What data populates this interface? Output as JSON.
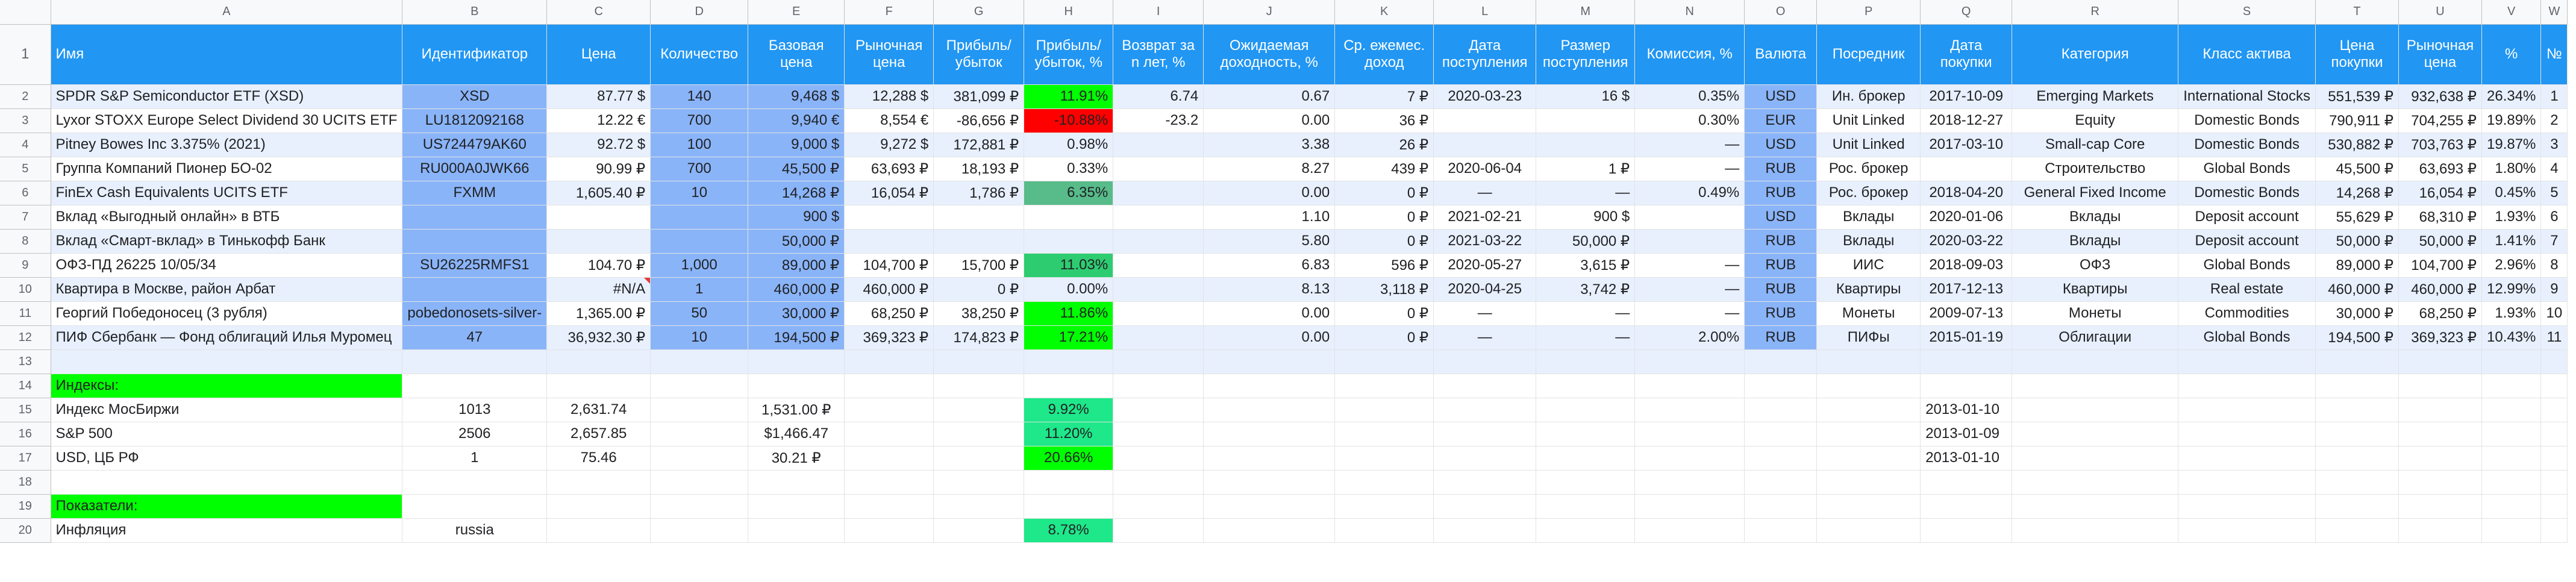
{
  "columns": [
    "A",
    "B",
    "C",
    "D",
    "E",
    "F",
    "G",
    "H",
    "I",
    "J",
    "K",
    "L",
    "M",
    "N",
    "O",
    "P",
    "Q",
    "R",
    "S",
    "T",
    "U",
    "V",
    "W"
  ],
  "header": [
    "Имя",
    "Идентификатор",
    "Цена",
    "Количество",
    "Базовая цена",
    "Рыночная цена",
    "Прибыль/ убыток",
    "Прибыль/ убыток, %",
    "Возврат за n лет, %",
    "Ожидаемая доходность, %",
    "Ср. ежемес. доход",
    "Дата поступления",
    "Размер поступления",
    "Комиссия, %",
    "Валюта",
    "Посредник",
    "Дата покупки",
    "Категория",
    "Класс актива",
    "Цена покупки",
    "Рыночная цена",
    "%",
    "№"
  ],
  "rows": [
    [
      "SPDR S&P Semiconductor ETF (XSD)",
      "XSD",
      "87.77 $",
      "140",
      "9,468 $",
      "12,288 $",
      "381,099 ₽",
      "11.91%",
      "6.74",
      "0.67",
      "7 ₽",
      "2020-03-23",
      "16 $",
      "0.35%",
      "USD",
      "Ин. брокер",
      "2017-10-09",
      "Emerging Markets",
      "International Stocks",
      "551,539 ₽",
      "932,638 ₽",
      "26.34%",
      "1"
    ],
    [
      "Lyxor STOXX Europe Select Dividend 30 UCITS ETF",
      "LU1812092168",
      "12.22 €",
      "700",
      "9,940 €",
      "8,554 €",
      "-86,656 ₽",
      "-10.88%",
      "-23.2",
      "0.00",
      "36 ₽",
      "",
      "",
      "0.30%",
      "EUR",
      "Unit Linked",
      "2018-12-27",
      "Equity",
      "Domestic Bonds",
      "790,911 ₽",
      "704,255 ₽",
      "19.89%",
      "2"
    ],
    [
      "Pitney Bowes Inc 3.375% (2021)",
      "US724479AK60",
      "92.72 $",
      "100",
      "9,000 $",
      "9,272 $",
      "172,881 ₽",
      "0.98%",
      "",
      "3.38",
      "26 ₽",
      "",
      "",
      "—",
      "USD",
      "Unit Linked",
      "2017-03-10",
      "Small-cap Core",
      "Domestic Bonds",
      "530,882 ₽",
      "703,763 ₽",
      "19.87%",
      "3"
    ],
    [
      "Группа Компаний Пионер БО-02",
      "RU000A0JWK66",
      "90.99 ₽",
      "700",
      "45,500 ₽",
      "63,693 ₽",
      "18,193 ₽",
      "0.33%",
      "",
      "8.27",
      "439 ₽",
      "2020-06-04",
      "1 ₽",
      "—",
      "RUB",
      "Рос. брокер",
      "",
      "Строительство",
      "Global Bonds",
      "45,500 ₽",
      "63,693 ₽",
      "1.80%",
      "4"
    ],
    [
      "FinEx Cash Equivalents UCITS ETF",
      "FXMM",
      "1,605.40 ₽",
      "10",
      "14,268 ₽",
      "16,054 ₽",
      "1,786 ₽",
      "6.35%",
      "",
      "0.00",
      "0 ₽",
      "—",
      "—",
      "0.49%",
      "RUB",
      "Рос. брокер",
      "2018-04-20",
      "General Fixed Income",
      "Domestic Bonds",
      "14,268 ₽",
      "16,054 ₽",
      "0.45%",
      "5"
    ],
    [
      "Вклад «Выгодный онлайн» в ВТБ",
      "",
      "",
      "",
      "900 $",
      "",
      "",
      "",
      "",
      "1.10",
      "0 ₽",
      "2021-02-21",
      "900 $",
      "",
      "USD",
      "Вклады",
      "2020-01-06",
      "Вклады",
      "Deposit account",
      "55,629 ₽",
      "68,310 ₽",
      "1.93%",
      "6"
    ],
    [
      "Вклад «Смарт-вклад» в Тинькофф Банк",
      "",
      "",
      "",
      "50,000 ₽",
      "",
      "",
      "",
      "",
      "5.80",
      "0 ₽",
      "2021-03-22",
      "50,000 ₽",
      "",
      "RUB",
      "Вклады",
      "2020-03-22",
      "Вклады",
      "Deposit account",
      "50,000 ₽",
      "50,000 ₽",
      "1.41%",
      "7"
    ],
    [
      "ОФЗ-ПД 26225 10/05/34",
      "SU26225RMFS1",
      "104.70 ₽",
      "1,000",
      "89,000 ₽",
      "104,700 ₽",
      "15,700 ₽",
      "11.03%",
      "",
      "6.83",
      "596 ₽",
      "2020-05-27",
      "3,615 ₽",
      "—",
      "RUB",
      "ИИС",
      "2018-09-03",
      "ОФЗ",
      "Global Bonds",
      "89,000 ₽",
      "104,700 ₽",
      "2.96%",
      "8"
    ],
    [
      "Квартира в Москве, район Арбат",
      "",
      "#N/A",
      "1",
      "460,000 ₽",
      "460,000 ₽",
      "0 ₽",
      "0.00%",
      "",
      "8.13",
      "3,118 ₽",
      "2020-04-25",
      "3,742 ₽",
      "—",
      "RUB",
      "Квартиры",
      "2017-12-13",
      "Квартиры",
      "Real estate",
      "460,000 ₽",
      "460,000 ₽",
      "12.99%",
      "9"
    ],
    [
      "Георгий Победоносец (3 рубля)",
      "pobedonosets-silver-",
      "1,365.00 ₽",
      "50",
      "30,000 ₽",
      "68,250 ₽",
      "38,250 ₽",
      "11.86%",
      "",
      "0.00",
      "0 ₽",
      "—",
      "—",
      "—",
      "RUB",
      "Монеты",
      "2009-07-13",
      "Монеты",
      "Commodities",
      "30,000 ₽",
      "68,250 ₽",
      "1.93%",
      "10"
    ],
    [
      "ПИФ Сбербанк — Фонд облигаций Илья Муромец",
      "47",
      "36,932.30 ₽",
      "10",
      "194,500 ₽",
      "369,323 ₽",
      "174,823 ₽",
      "17.21%",
      "",
      "0.00",
      "0 ₽",
      "—",
      "—",
      "2.00%",
      "RUB",
      "ПИФы",
      "2015-01-19",
      "Облигации",
      "Global Bonds",
      "194,500 ₽",
      "369,323 ₽",
      "10.43%",
      "11"
    ]
  ],
  "indices_label": "Индексы:",
  "indices": [
    {
      "name": "Индекс МосБиржи",
      "id": "1013",
      "price": "2,631.74",
      "base": "1,531.00 ₽",
      "pct": "9.92%",
      "date": "2013-01-10"
    },
    {
      "name": "S&P 500",
      "id": "2506",
      "price": "2,657.85",
      "base": "$1,466.47",
      "pct": "11.20%",
      "date": "2013-01-09"
    },
    {
      "name": "USD, ЦБ РФ",
      "id": "1",
      "price": "75.46",
      "base": "30.21 ₽",
      "pct": "20.66%",
      "date": "2013-01-10"
    }
  ],
  "indicators_label": "Показатели:",
  "indicators": [
    {
      "name": "Инфляция",
      "id": "russia",
      "pct": "8.78%"
    }
  ],
  "row_numbers": [
    "1",
    "2",
    "3",
    "4",
    "5",
    "6",
    "7",
    "8",
    "9",
    "10",
    "11",
    "12",
    "13",
    "14",
    "15",
    "16",
    "17",
    "18",
    "19",
    "20"
  ]
}
